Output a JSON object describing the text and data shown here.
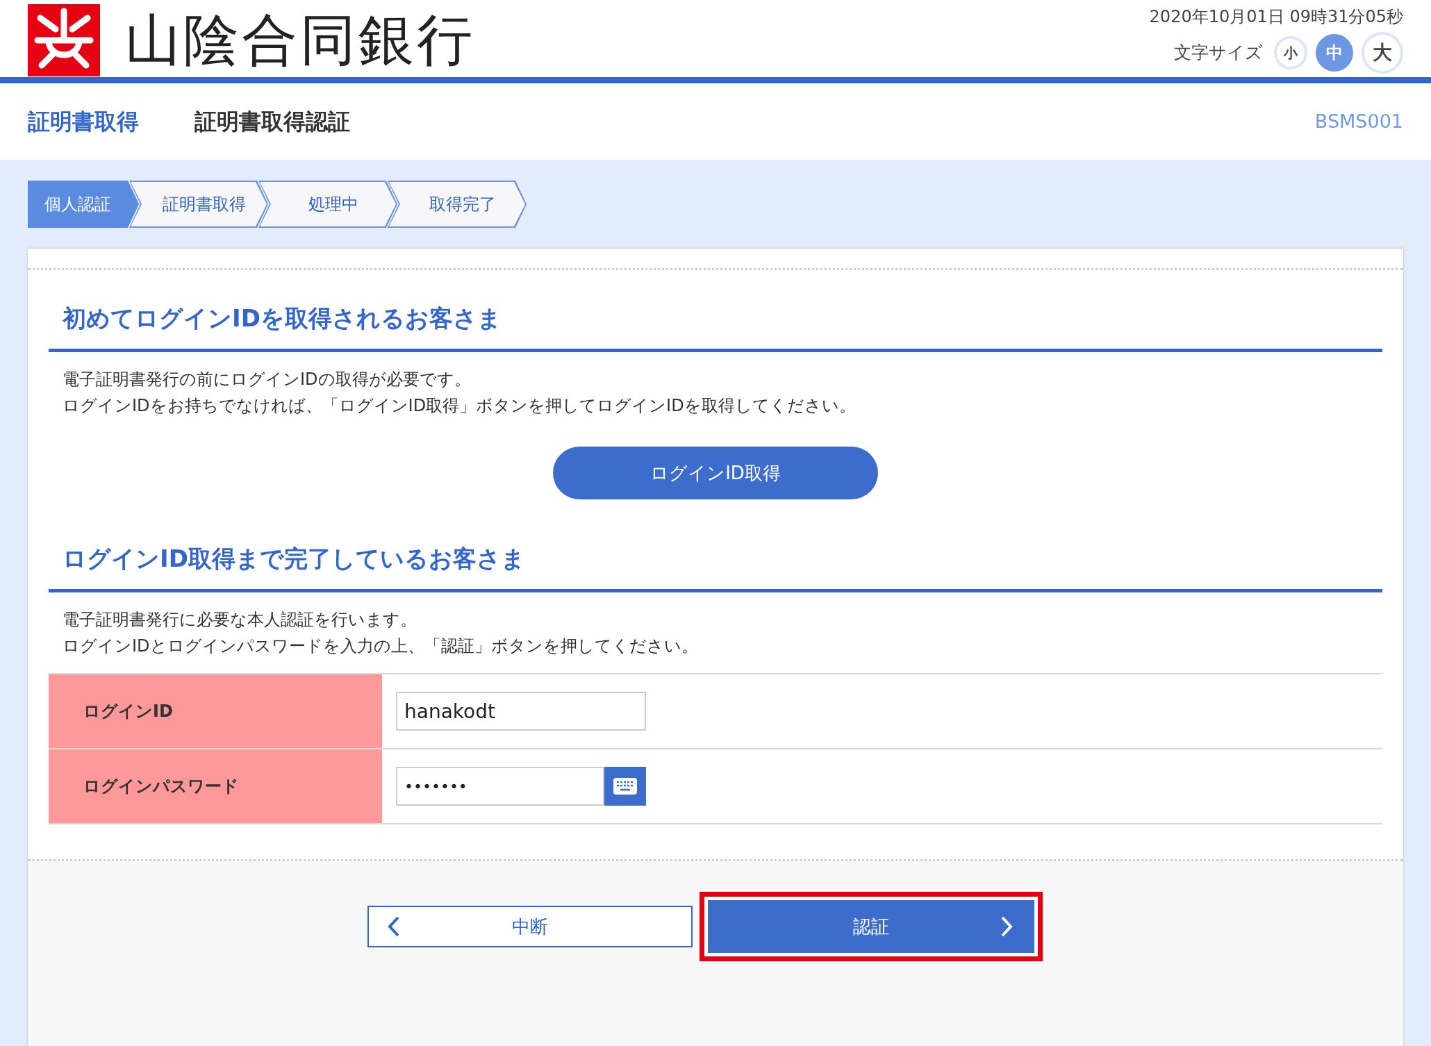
{
  "header": {
    "bank_name": "山陰合同銀行",
    "datetime": "2020年10月01日 09時31分05秒",
    "font_size_label": "文字サイズ",
    "font_sizes": [
      {
        "label": "小",
        "selected": false
      },
      {
        "label": "中",
        "selected": true
      },
      {
        "label": "大",
        "selected": false
      }
    ]
  },
  "title_bar": {
    "titles": [
      {
        "text": "証明書取得",
        "selected": true
      },
      {
        "text": "証明書取得認証",
        "selected": false
      }
    ],
    "screen_code": "BSMS001"
  },
  "steps": [
    {
      "label": "個人認証",
      "selected": true
    },
    {
      "label": "証明書取得",
      "selected": false
    },
    {
      "label": "処理中",
      "selected": false
    },
    {
      "label": "取得完了",
      "selected": false
    }
  ],
  "sections": [
    {
      "heading": "初めてログインIDを取得されるお客さま",
      "lines": [
        "電子証明書発行の前にログインIDの取得が必要です。",
        "ログインIDをお持ちでなければ、「ログインID取得」ボタンを押してログインIDを取得してください。"
      ],
      "button": "ログインID取得"
    },
    {
      "heading": "ログインID取得まで完了しているお客さま",
      "lines": [
        "電子証明書発行に必要な本人認証を行います。",
        "ログインIDとログインパスワードを入力の上、「認証」ボタンを押してください。"
      ]
    }
  ],
  "form": [
    {
      "label": "ログインID",
      "kind": "text",
      "value": "hanakodt"
    },
    {
      "label": "ログインパスワード",
      "kind": "password",
      "value": "•••••••"
    }
  ],
  "buttons": [
    {
      "label": "中断",
      "kind": "back",
      "highlighted": false
    },
    {
      "label": "認証",
      "kind": "next",
      "highlighted": true
    }
  ]
}
